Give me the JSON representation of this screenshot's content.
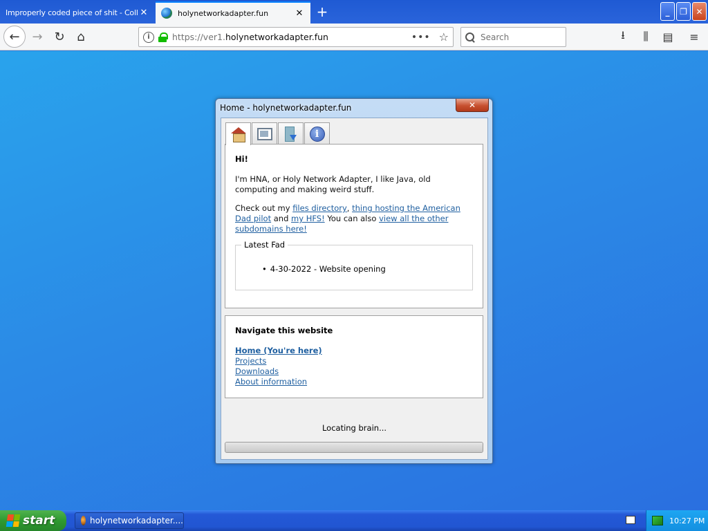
{
  "browser": {
    "tabs": [
      {
        "title": "Improperly coded piece of shit - Collab",
        "active": false
      },
      {
        "title": "holynetworkadapter.fun",
        "active": true
      }
    ],
    "url_scheme": "https://ver1.",
    "url_domain": "holynetworkadapter.fun",
    "search_placeholder": "Search",
    "icons": {
      "back": "←",
      "forward": "→",
      "reload": "↻",
      "home": "⌂",
      "more": "•••",
      "star": "☆",
      "download": "⭳",
      "library": "⫼",
      "sidebar": "▤",
      "menu": "≡",
      "tab_close": "✕",
      "new_tab": "+",
      "win_min": "_",
      "win_max": "❐",
      "win_close": "✕",
      "info": "i"
    }
  },
  "app": {
    "window_title": "Home - holynetworkadapter.fun",
    "close_glyph": "✕",
    "tabs": [
      "home",
      "projects",
      "downloads",
      "about"
    ],
    "home": {
      "greeting": "Hi!",
      "intro": "I'm HNA, or Holy Network Adapter, I like Java, old computing and making weird stuff.",
      "check_prefix": "Check out my ",
      "link_files": "files directory",
      "comma": ", ",
      "link_american_dad": "thing hosting the American Dad pilot",
      "and": " and ",
      "link_hfs": "my HFS!",
      "also": " You can also ",
      "link_subdomains": "view all the other subdomains here!",
      "fad_legend": "Latest Fad",
      "fad_item": "4-30-2022 - Website opening"
    },
    "nav": {
      "heading": "Navigate this website",
      "links": [
        "Home (You're here)",
        "Projects",
        "Downloads",
        "About information"
      ]
    },
    "status": "Locating brain...",
    "progress": 1.0
  },
  "taskbar": {
    "start_label": "start",
    "task_label": "holynetworkadapter....",
    "clock": "10:27 PM"
  }
}
